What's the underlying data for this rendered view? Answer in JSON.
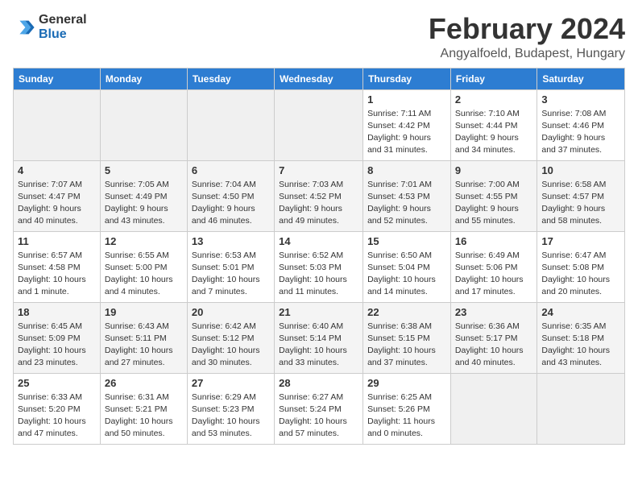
{
  "header": {
    "logo_line1": "General",
    "logo_line2": "Blue",
    "month": "February 2024",
    "location": "Angyalfoeld, Budapest, Hungary"
  },
  "weekdays": [
    "Sunday",
    "Monday",
    "Tuesday",
    "Wednesday",
    "Thursday",
    "Friday",
    "Saturday"
  ],
  "weeks": [
    [
      {
        "day": "",
        "sunrise": "",
        "sunset": "",
        "daylight": "",
        "empty": true
      },
      {
        "day": "",
        "sunrise": "",
        "sunset": "",
        "daylight": "",
        "empty": true
      },
      {
        "day": "",
        "sunrise": "",
        "sunset": "",
        "daylight": "",
        "empty": true
      },
      {
        "day": "",
        "sunrise": "",
        "sunset": "",
        "daylight": "",
        "empty": true
      },
      {
        "day": "1",
        "sunrise": "Sunrise: 7:11 AM",
        "sunset": "Sunset: 4:42 PM",
        "daylight": "Daylight: 9 hours and 31 minutes.",
        "empty": false
      },
      {
        "day": "2",
        "sunrise": "Sunrise: 7:10 AM",
        "sunset": "Sunset: 4:44 PM",
        "daylight": "Daylight: 9 hours and 34 minutes.",
        "empty": false
      },
      {
        "day": "3",
        "sunrise": "Sunrise: 7:08 AM",
        "sunset": "Sunset: 4:46 PM",
        "daylight": "Daylight: 9 hours and 37 minutes.",
        "empty": false
      }
    ],
    [
      {
        "day": "4",
        "sunrise": "Sunrise: 7:07 AM",
        "sunset": "Sunset: 4:47 PM",
        "daylight": "Daylight: 9 hours and 40 minutes.",
        "empty": false
      },
      {
        "day": "5",
        "sunrise": "Sunrise: 7:05 AM",
        "sunset": "Sunset: 4:49 PM",
        "daylight": "Daylight: 9 hours and 43 minutes.",
        "empty": false
      },
      {
        "day": "6",
        "sunrise": "Sunrise: 7:04 AM",
        "sunset": "Sunset: 4:50 PM",
        "daylight": "Daylight: 9 hours and 46 minutes.",
        "empty": false
      },
      {
        "day": "7",
        "sunrise": "Sunrise: 7:03 AM",
        "sunset": "Sunset: 4:52 PM",
        "daylight": "Daylight: 9 hours and 49 minutes.",
        "empty": false
      },
      {
        "day": "8",
        "sunrise": "Sunrise: 7:01 AM",
        "sunset": "Sunset: 4:53 PM",
        "daylight": "Daylight: 9 hours and 52 minutes.",
        "empty": false
      },
      {
        "day": "9",
        "sunrise": "Sunrise: 7:00 AM",
        "sunset": "Sunset: 4:55 PM",
        "daylight": "Daylight: 9 hours and 55 minutes.",
        "empty": false
      },
      {
        "day": "10",
        "sunrise": "Sunrise: 6:58 AM",
        "sunset": "Sunset: 4:57 PM",
        "daylight": "Daylight: 9 hours and 58 minutes.",
        "empty": false
      }
    ],
    [
      {
        "day": "11",
        "sunrise": "Sunrise: 6:57 AM",
        "sunset": "Sunset: 4:58 PM",
        "daylight": "Daylight: 10 hours and 1 minute.",
        "empty": false
      },
      {
        "day": "12",
        "sunrise": "Sunrise: 6:55 AM",
        "sunset": "Sunset: 5:00 PM",
        "daylight": "Daylight: 10 hours and 4 minutes.",
        "empty": false
      },
      {
        "day": "13",
        "sunrise": "Sunrise: 6:53 AM",
        "sunset": "Sunset: 5:01 PM",
        "daylight": "Daylight: 10 hours and 7 minutes.",
        "empty": false
      },
      {
        "day": "14",
        "sunrise": "Sunrise: 6:52 AM",
        "sunset": "Sunset: 5:03 PM",
        "daylight": "Daylight: 10 hours and 11 minutes.",
        "empty": false
      },
      {
        "day": "15",
        "sunrise": "Sunrise: 6:50 AM",
        "sunset": "Sunset: 5:04 PM",
        "daylight": "Daylight: 10 hours and 14 minutes.",
        "empty": false
      },
      {
        "day": "16",
        "sunrise": "Sunrise: 6:49 AM",
        "sunset": "Sunset: 5:06 PM",
        "daylight": "Daylight: 10 hours and 17 minutes.",
        "empty": false
      },
      {
        "day": "17",
        "sunrise": "Sunrise: 6:47 AM",
        "sunset": "Sunset: 5:08 PM",
        "daylight": "Daylight: 10 hours and 20 minutes.",
        "empty": false
      }
    ],
    [
      {
        "day": "18",
        "sunrise": "Sunrise: 6:45 AM",
        "sunset": "Sunset: 5:09 PM",
        "daylight": "Daylight: 10 hours and 23 minutes.",
        "empty": false
      },
      {
        "day": "19",
        "sunrise": "Sunrise: 6:43 AM",
        "sunset": "Sunset: 5:11 PM",
        "daylight": "Daylight: 10 hours and 27 minutes.",
        "empty": false
      },
      {
        "day": "20",
        "sunrise": "Sunrise: 6:42 AM",
        "sunset": "Sunset: 5:12 PM",
        "daylight": "Daylight: 10 hours and 30 minutes.",
        "empty": false
      },
      {
        "day": "21",
        "sunrise": "Sunrise: 6:40 AM",
        "sunset": "Sunset: 5:14 PM",
        "daylight": "Daylight: 10 hours and 33 minutes.",
        "empty": false
      },
      {
        "day": "22",
        "sunrise": "Sunrise: 6:38 AM",
        "sunset": "Sunset: 5:15 PM",
        "daylight": "Daylight: 10 hours and 37 minutes.",
        "empty": false
      },
      {
        "day": "23",
        "sunrise": "Sunrise: 6:36 AM",
        "sunset": "Sunset: 5:17 PM",
        "daylight": "Daylight: 10 hours and 40 minutes.",
        "empty": false
      },
      {
        "day": "24",
        "sunrise": "Sunrise: 6:35 AM",
        "sunset": "Sunset: 5:18 PM",
        "daylight": "Daylight: 10 hours and 43 minutes.",
        "empty": false
      }
    ],
    [
      {
        "day": "25",
        "sunrise": "Sunrise: 6:33 AM",
        "sunset": "Sunset: 5:20 PM",
        "daylight": "Daylight: 10 hours and 47 minutes.",
        "empty": false
      },
      {
        "day": "26",
        "sunrise": "Sunrise: 6:31 AM",
        "sunset": "Sunset: 5:21 PM",
        "daylight": "Daylight: 10 hours and 50 minutes.",
        "empty": false
      },
      {
        "day": "27",
        "sunrise": "Sunrise: 6:29 AM",
        "sunset": "Sunset: 5:23 PM",
        "daylight": "Daylight: 10 hours and 53 minutes.",
        "empty": false
      },
      {
        "day": "28",
        "sunrise": "Sunrise: 6:27 AM",
        "sunset": "Sunset: 5:24 PM",
        "daylight": "Daylight: 10 hours and 57 minutes.",
        "empty": false
      },
      {
        "day": "29",
        "sunrise": "Sunrise: 6:25 AM",
        "sunset": "Sunset: 5:26 PM",
        "daylight": "Daylight: 11 hours and 0 minutes.",
        "empty": false
      },
      {
        "day": "",
        "sunrise": "",
        "sunset": "",
        "daylight": "",
        "empty": true
      },
      {
        "day": "",
        "sunrise": "",
        "sunset": "",
        "daylight": "",
        "empty": true
      }
    ]
  ]
}
